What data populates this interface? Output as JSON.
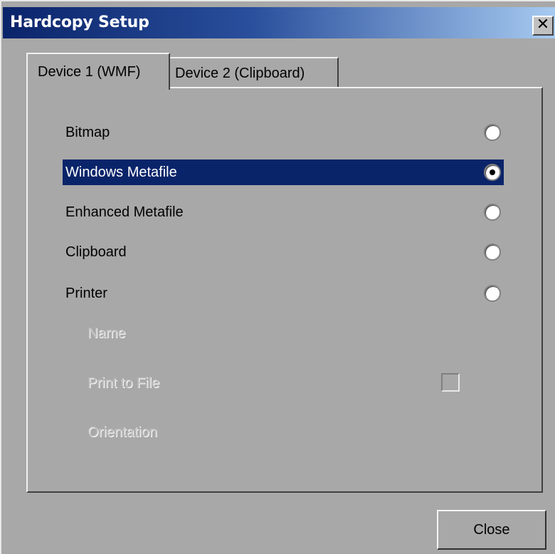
{
  "window": {
    "title": "Hardcopy Setup",
    "close_glyph": "✕"
  },
  "tabs": [
    {
      "label": "Device 1 (WMF)",
      "active": true
    },
    {
      "label": "Device 2 (Clipboard)",
      "active": false
    }
  ],
  "options": [
    {
      "label": "Bitmap",
      "selected": false
    },
    {
      "label": "Windows Metafile",
      "selected": true
    },
    {
      "label": "Enhanced Metafile",
      "selected": false
    },
    {
      "label": "Clipboard",
      "selected": false
    },
    {
      "label": "Printer",
      "selected": false
    }
  ],
  "printer_settings": {
    "name_label": "Name",
    "print_to_file_label": "Print to File",
    "print_to_file_checked": false,
    "orientation_label": "Orientation"
  },
  "buttons": {
    "close_label": "Close"
  },
  "colors": {
    "title_gradient_start": "#0a246a",
    "title_gradient_end": "#a6caf0",
    "selection": "#0a246a",
    "face": "#a8a8a8",
    "disabled_text": "#bdbdbd"
  }
}
